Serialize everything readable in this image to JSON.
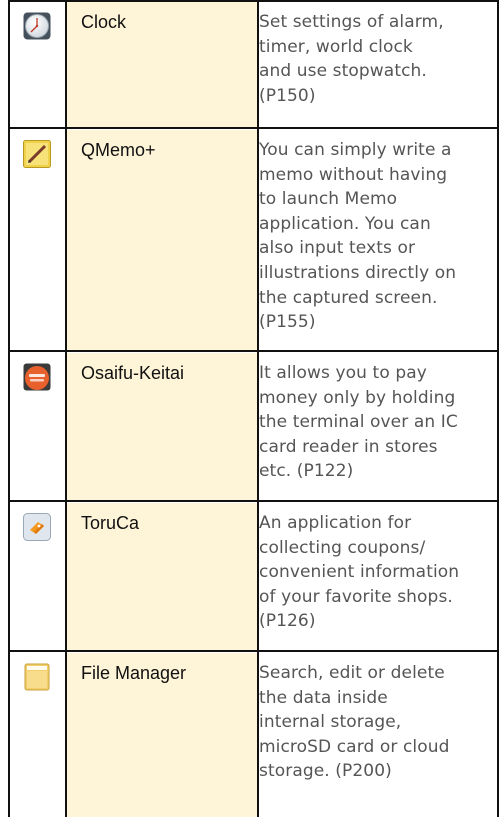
{
  "apps": [
    {
      "icon": "clock-icon",
      "name": "Clock",
      "lines": [
        "Set settings of alarm,",
        "timer, world clock",
        "and use stopwatch.",
        "(P150)"
      ]
    },
    {
      "icon": "qmemo-icon",
      "name": "QMemo+",
      "lines": [
        "You can simply write a",
        "memo without having",
        "to launch Memo",
        "application. You can",
        "also input texts or",
        "illustrations directly on",
        "the captured screen.",
        "(P155)"
      ]
    },
    {
      "icon": "osaifu-keitai-icon",
      "name": "Osaifu-Keitai",
      "lines": [
        "It allows you to pay",
        "money only by holding",
        "the terminal over an IC",
        "card reader in stores",
        "etc. (P122)"
      ]
    },
    {
      "icon": "toruca-icon",
      "name": "ToruCa",
      "lines": [
        "An application for",
        "collecting coupons/",
        "convenient information",
        "of your favorite shops.",
        "(P126)"
      ]
    },
    {
      "icon": "file-manager-icon",
      "name": "File Manager",
      "lines": [
        "Search, edit or delete",
        "the data inside",
        "internal storage,",
        "microSD card or cloud",
        "storage. (P200)"
      ]
    }
  ],
  "colors": {
    "name_cell_bg": "#fef4d8",
    "border": "#111111",
    "description_text": "#555555"
  }
}
